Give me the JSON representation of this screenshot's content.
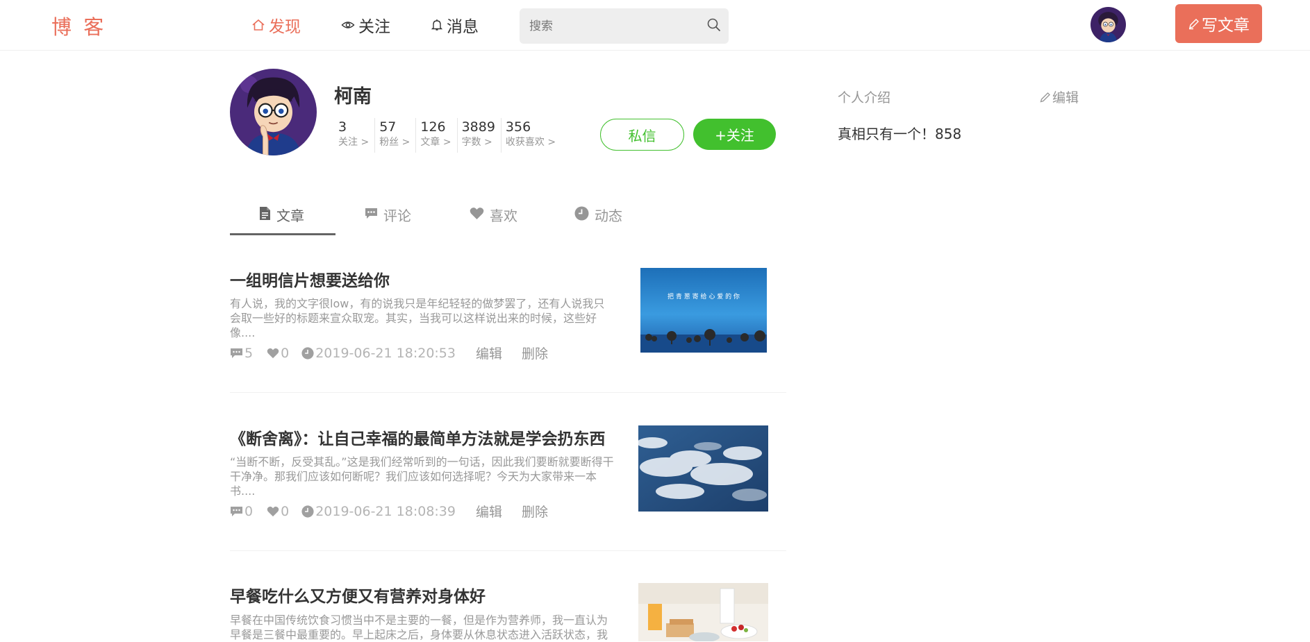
{
  "nav": {
    "logo": "博 客",
    "links": [
      {
        "label": "发现",
        "active": true
      },
      {
        "label": "关注",
        "active": false
      },
      {
        "label": "消息",
        "active": false
      }
    ],
    "search_placeholder": "搜索",
    "write_label": "写文章"
  },
  "colors": {
    "accent": "#ea6f5a",
    "green": "#42c02e",
    "muted": "#969696"
  },
  "profile": {
    "name": "柯南",
    "stats": [
      {
        "num": "3",
        "label": "关注 >"
      },
      {
        "num": "57",
        "label": "粉丝 >"
      },
      {
        "num": "126",
        "label": "文章 >"
      },
      {
        "num": "3889",
        "label": "字数 >"
      },
      {
        "num": "356",
        "label": "收获喜欢 >"
      }
    ],
    "message_button": "私信",
    "follow_button": "+关注"
  },
  "sidebar": {
    "intro_title": "个人介绍",
    "edit_label": "编辑",
    "intro_text": "真相只有一个！858"
  },
  "tabs": [
    {
      "label": "文章",
      "icon": "document-icon",
      "active": true
    },
    {
      "label": "评论",
      "icon": "comment-icon",
      "active": false
    },
    {
      "label": "喜欢",
      "icon": "heart-icon",
      "active": false
    },
    {
      "label": "动态",
      "icon": "clock-icon",
      "active": false
    }
  ],
  "articles": [
    {
      "title": "一组明信片想要送给你",
      "abstract": "有人说，我的文字很low，有的说我只是年纪轻轻的做梦罢了，还有人说我只会取一些好的标题来宣众取宠。其实，当我可以这样说出来的时候，这些好像....",
      "comments": "5",
      "likes": "0",
      "time": "2019-06-21 18:20:53",
      "edit": "编辑",
      "delete": "删除",
      "thumb_caption": "把 青 葱 寄 给 心 爱 的 你"
    },
    {
      "title": "《断舍离》：让自己幸福的最简单方法就是学会扔东西",
      "abstract": "“当断不断，反受其乱。”这是我们经常听到的一句话，因此我们要断就要断得干干净净。那我们应该如何断呢？我们应该如何选择呢？今天为大家带来一本书....",
      "comments": "0",
      "likes": "0",
      "time": "2019-06-21 18:08:39",
      "edit": "编辑",
      "delete": "删除"
    },
    {
      "title": "早餐吃什么又方便又有营养对身体好",
      "abstract": "早餐在中国传统饮食习惯当中不是主要的一餐，但是作为营养师，我一直认为早餐是三餐中最重要的。早上起床之后，身体要从休息状态进入活跃状态，我"
    }
  ]
}
